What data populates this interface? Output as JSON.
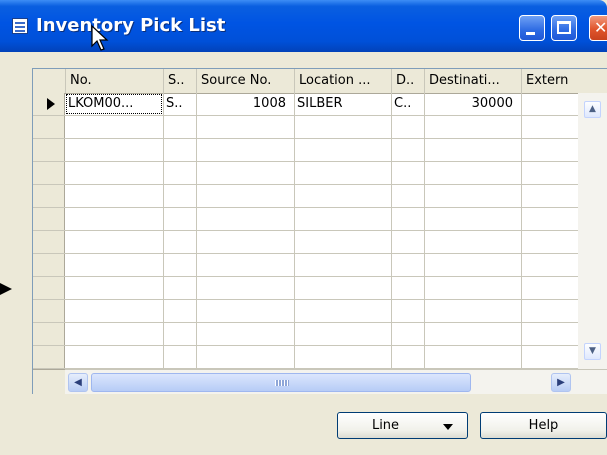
{
  "window": {
    "title": "Inventory Pick List",
    "icons": {
      "app": "list-window-icon",
      "minimize": "minimize-icon",
      "maximize": "maximize-icon",
      "close": "close-icon",
      "cursor": "mouse-cursor-icon",
      "pointer": "arrow-pointer-icon"
    }
  },
  "grid": {
    "columns": [
      "No.",
      "S..",
      "Source No.",
      "Location ...",
      "D..",
      "Destinati...",
      "Extern"
    ],
    "rows": [
      {
        "no": "LKOM00...",
        "s": "S..",
        "source_no": "1008",
        "location": "SILBER",
        "d": "C..",
        "destination": "30000",
        "external": ""
      }
    ],
    "empty_row_count": 9
  },
  "buttons": {
    "line": "Line",
    "help": "Help"
  },
  "colors": {
    "titlebar": "#0054e3",
    "window_bg": "#ece9d8",
    "grid_bg": "#ffffff"
  }
}
